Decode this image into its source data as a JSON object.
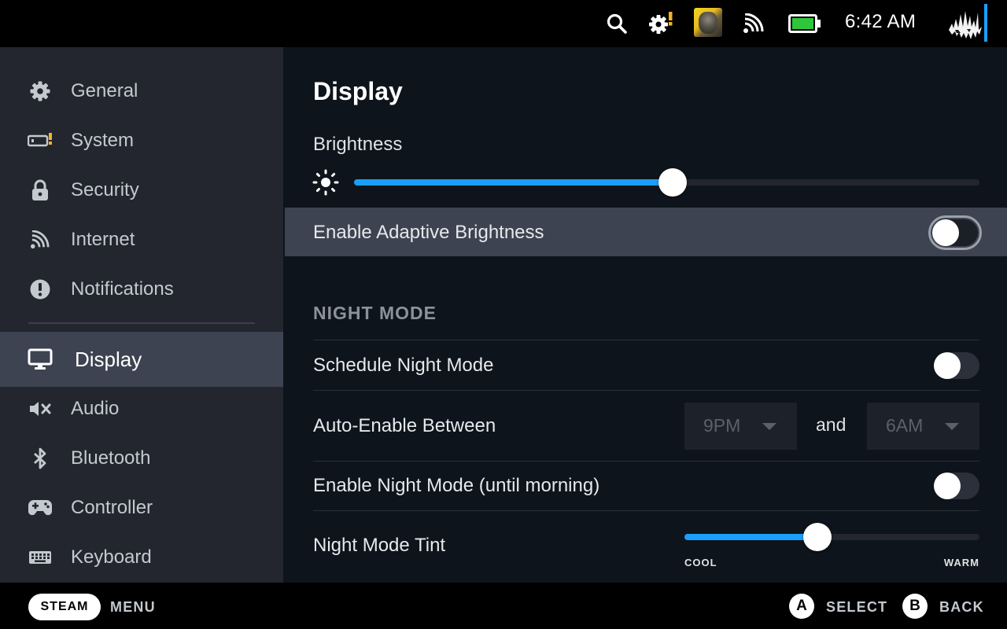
{
  "status_bar": {
    "time": "6:42 AM",
    "icons": [
      "search-icon",
      "settings-gear-alert-icon",
      "game-thumbnail",
      "wifi-icon",
      "battery-icon",
      "avatar"
    ],
    "battery_color": "#2ec63a",
    "accent": "#1a9fff"
  },
  "sidebar": {
    "items": [
      {
        "label": "General",
        "icon": "gear-icon"
      },
      {
        "label": "System",
        "icon": "system-icon"
      },
      {
        "label": "Security",
        "icon": "lock-icon"
      },
      {
        "label": "Internet",
        "icon": "wifi-icon"
      },
      {
        "label": "Notifications",
        "icon": "alert-icon"
      },
      {
        "label": "Display",
        "icon": "monitor-icon",
        "active": true
      },
      {
        "label": "Audio",
        "icon": "speaker-muted-icon"
      },
      {
        "label": "Bluetooth",
        "icon": "bluetooth-icon"
      },
      {
        "label": "Controller",
        "icon": "gamepad-icon"
      },
      {
        "label": "Keyboard",
        "icon": "keyboard-icon"
      }
    ]
  },
  "main": {
    "title": "Display",
    "brightness": {
      "label": "Brightness",
      "value": 0.51
    },
    "adaptive_brightness": {
      "label": "Enable Adaptive Brightness",
      "on": false
    },
    "night_mode": {
      "header": "NIGHT MODE",
      "schedule": {
        "label": "Schedule Night Mode",
        "on": false
      },
      "auto_enable": {
        "label": "Auto-Enable Between",
        "start": "9PM",
        "joiner": "and",
        "end": "6AM"
      },
      "enable_until_morning": {
        "label": "Enable Night Mode (until morning)",
        "on": false
      },
      "tint": {
        "label": "Night Mode Tint",
        "value": 0.45,
        "min_label": "COOL",
        "max_label": "WARM"
      }
    }
  },
  "bottom_bar": {
    "steam_label": "STEAM",
    "menu_label": "MENU",
    "a_glyph": "A",
    "select_label": "SELECT",
    "b_glyph": "B",
    "back_label": "BACK"
  }
}
